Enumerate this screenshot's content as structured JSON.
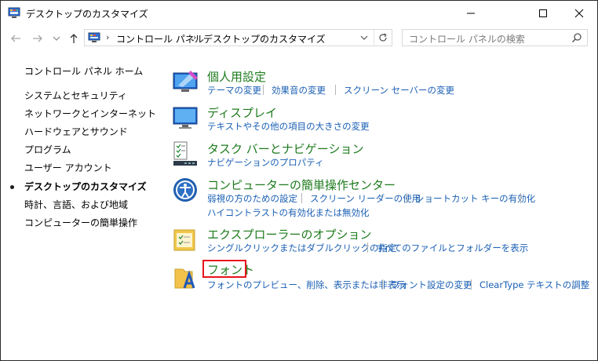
{
  "window": {
    "title": "デスクトップのカスタマイズ"
  },
  "address": {
    "crumbs": [
      "コントロール パネル",
      "デスクトップのカスタマイズ"
    ],
    "search_placeholder": "コントロール パネルの検索"
  },
  "sidebar": {
    "items": [
      {
        "label": "コントロール パネル ホーム"
      },
      {
        "label": "システムとセキュリティ"
      },
      {
        "label": "ネットワークとインターネット"
      },
      {
        "label": "ハードウェアとサウンド"
      },
      {
        "label": "プログラム"
      },
      {
        "label": "ユーザー アカウント"
      },
      {
        "label": "デスクトップのカスタマイズ",
        "current": true
      },
      {
        "label": "時計、言語、および地域"
      },
      {
        "label": "コンピューターの簡単操作"
      }
    ]
  },
  "categories": [
    {
      "title": "個人用設定",
      "links": [
        "テーマの変更",
        "効果音の変更",
        "スクリーン セーバーの変更"
      ]
    },
    {
      "title": "ディスプレイ",
      "links": [
        "テキストやその他の項目の大きさの変更"
      ]
    },
    {
      "title": "タスク バーとナビゲーション",
      "links": [
        "ナビゲーションのプロパティ"
      ]
    },
    {
      "title": "コンピューターの簡単操作センター",
      "links": [
        "弱視の方のための設定",
        "スクリーン リーダーの使用",
        "ショートカット キーの有効化",
        "ハイコントラストの有効化または無効化"
      ]
    },
    {
      "title": "エクスプローラーのオプション",
      "links": [
        "シングルクリックまたはダブルクリックの指定",
        "すべてのファイルとフォルダーを表示"
      ]
    },
    {
      "title": "フォント",
      "links": [
        "フォントのプレビュー、削除、表示または非表示",
        "フォント設定の変更",
        "ClearType テキストの調整"
      ]
    }
  ],
  "colors": {
    "category_title": "#1e7b1e",
    "link": "#1a5fb4",
    "highlight_box": "#e8141c"
  }
}
